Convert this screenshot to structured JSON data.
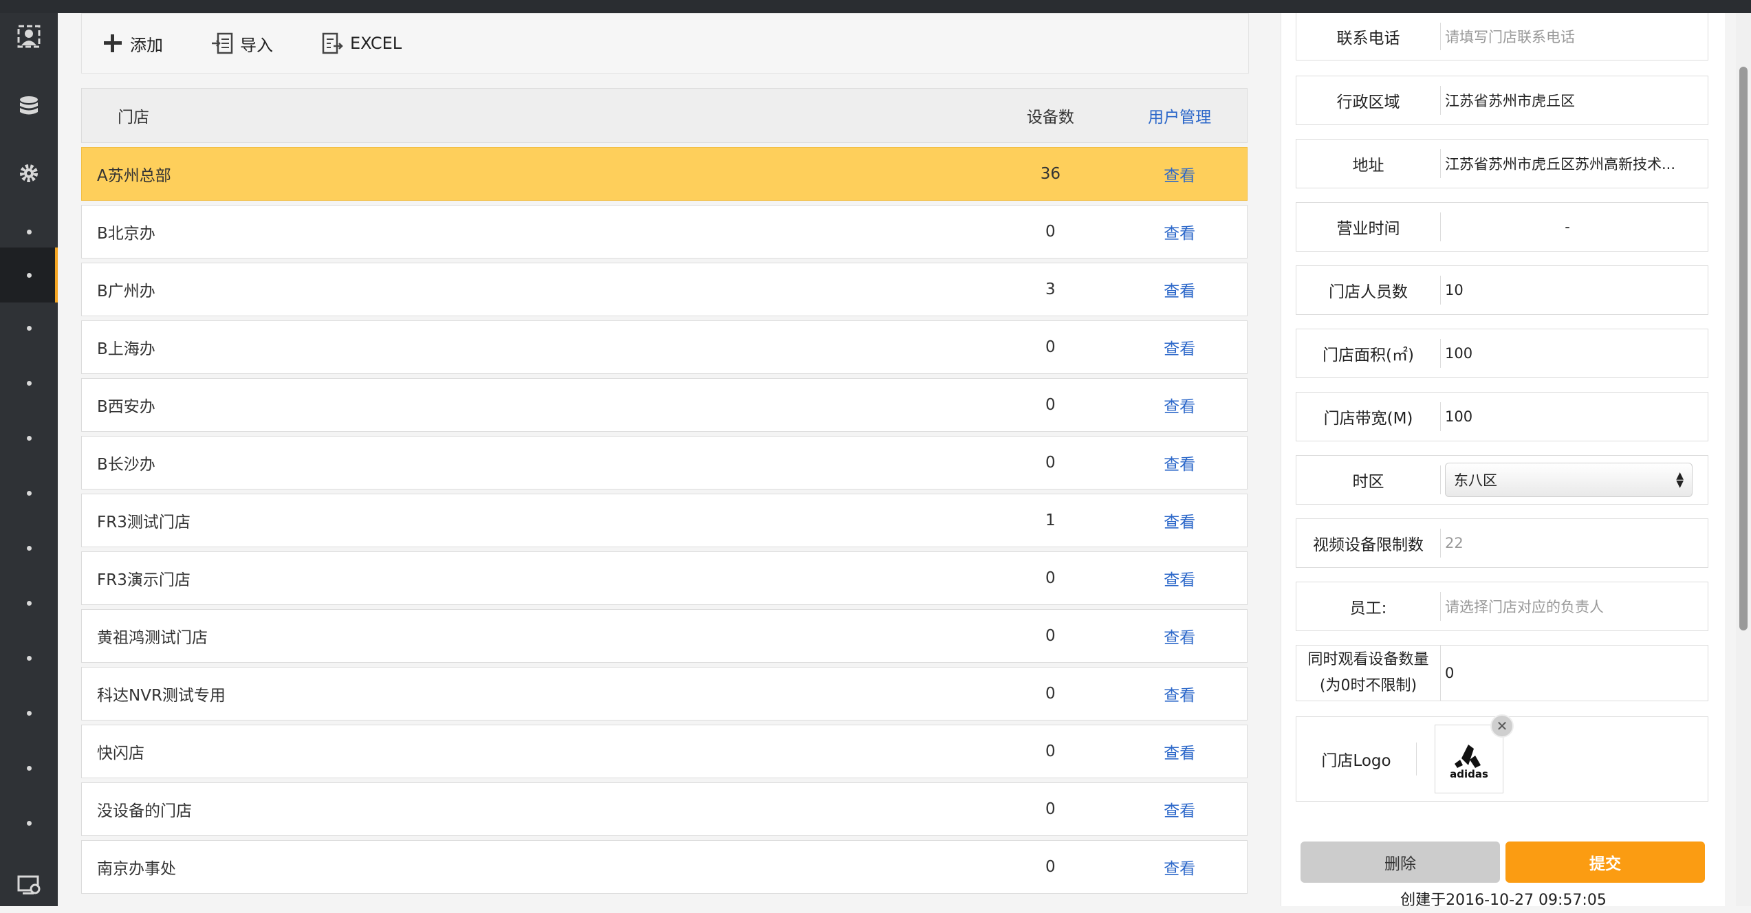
{
  "toolbar": {
    "add_label": "添加",
    "import_label": "导入",
    "excel_label": "EXCEL"
  },
  "table": {
    "headers": {
      "name": "门店",
      "count": "设备数",
      "action": "用户管理"
    },
    "rows": [
      {
        "name": "A苏州总部",
        "count": "36",
        "action": "查看"
      },
      {
        "name": "B北京办",
        "count": "0",
        "action": "查看"
      },
      {
        "name": "B广州办",
        "count": "3",
        "action": "查看"
      },
      {
        "name": "B上海办",
        "count": "0",
        "action": "查看"
      },
      {
        "name": "B西安办",
        "count": "0",
        "action": "查看"
      },
      {
        "name": "B长沙办",
        "count": "0",
        "action": "查看"
      },
      {
        "name": "FR3测试门店",
        "count": "1",
        "action": "查看"
      },
      {
        "name": "FR3演示门店",
        "count": "0",
        "action": "查看"
      },
      {
        "name": "黄祖鸿测试门店",
        "count": "0",
        "action": "查看"
      },
      {
        "name": "科达NVR测试专用",
        "count": "0",
        "action": "查看"
      },
      {
        "name": "快闪店",
        "count": "0",
        "action": "查看"
      },
      {
        "name": "没设备的门店",
        "count": "0",
        "action": "查看"
      },
      {
        "name": "南京办事处",
        "count": "0",
        "action": "查看"
      }
    ]
  },
  "form": {
    "phone": {
      "label": "联系电话",
      "placeholder": "请填写门店联系电话"
    },
    "region": {
      "label": "行政区域",
      "value": "江苏省苏州市虎丘区"
    },
    "address": {
      "label": "地址",
      "value": "江苏省苏州市虎丘区苏州高新技术..."
    },
    "hours": {
      "label": "营业时间",
      "value": "-"
    },
    "staff_count": {
      "label": "门店人员数",
      "value": "10"
    },
    "area": {
      "label": "门店面积(㎡)",
      "value": "100"
    },
    "bandwidth": {
      "label": "门店带宽(M)",
      "value": "100"
    },
    "timezone": {
      "label": "时区",
      "value": "东八区"
    },
    "video_limit": {
      "label": "视频设备限制数",
      "value": "22"
    },
    "employee": {
      "label": "员工:",
      "placeholder": "请选择门店对应的负责人"
    },
    "concurrent": {
      "label_line1": "同时观看设备数量",
      "label_line2": "(为0时不限制)",
      "value": "0"
    },
    "logo": {
      "label": "门店Logo",
      "brand_text": "adidas"
    },
    "delete_label": "删除",
    "submit_label": "提交",
    "created": "创建于2016-10-27 09:57:05"
  },
  "colors": {
    "accent": "#fb9c12",
    "selected_row": "#fecf5b",
    "link": "#2b67c9",
    "sidebar": "#2f3236"
  },
  "sidebar": {
    "icons": [
      "user-icon",
      "database-icon",
      "settings-gear-icon"
    ],
    "bottom_icon": "monitor-settings-icon"
  }
}
